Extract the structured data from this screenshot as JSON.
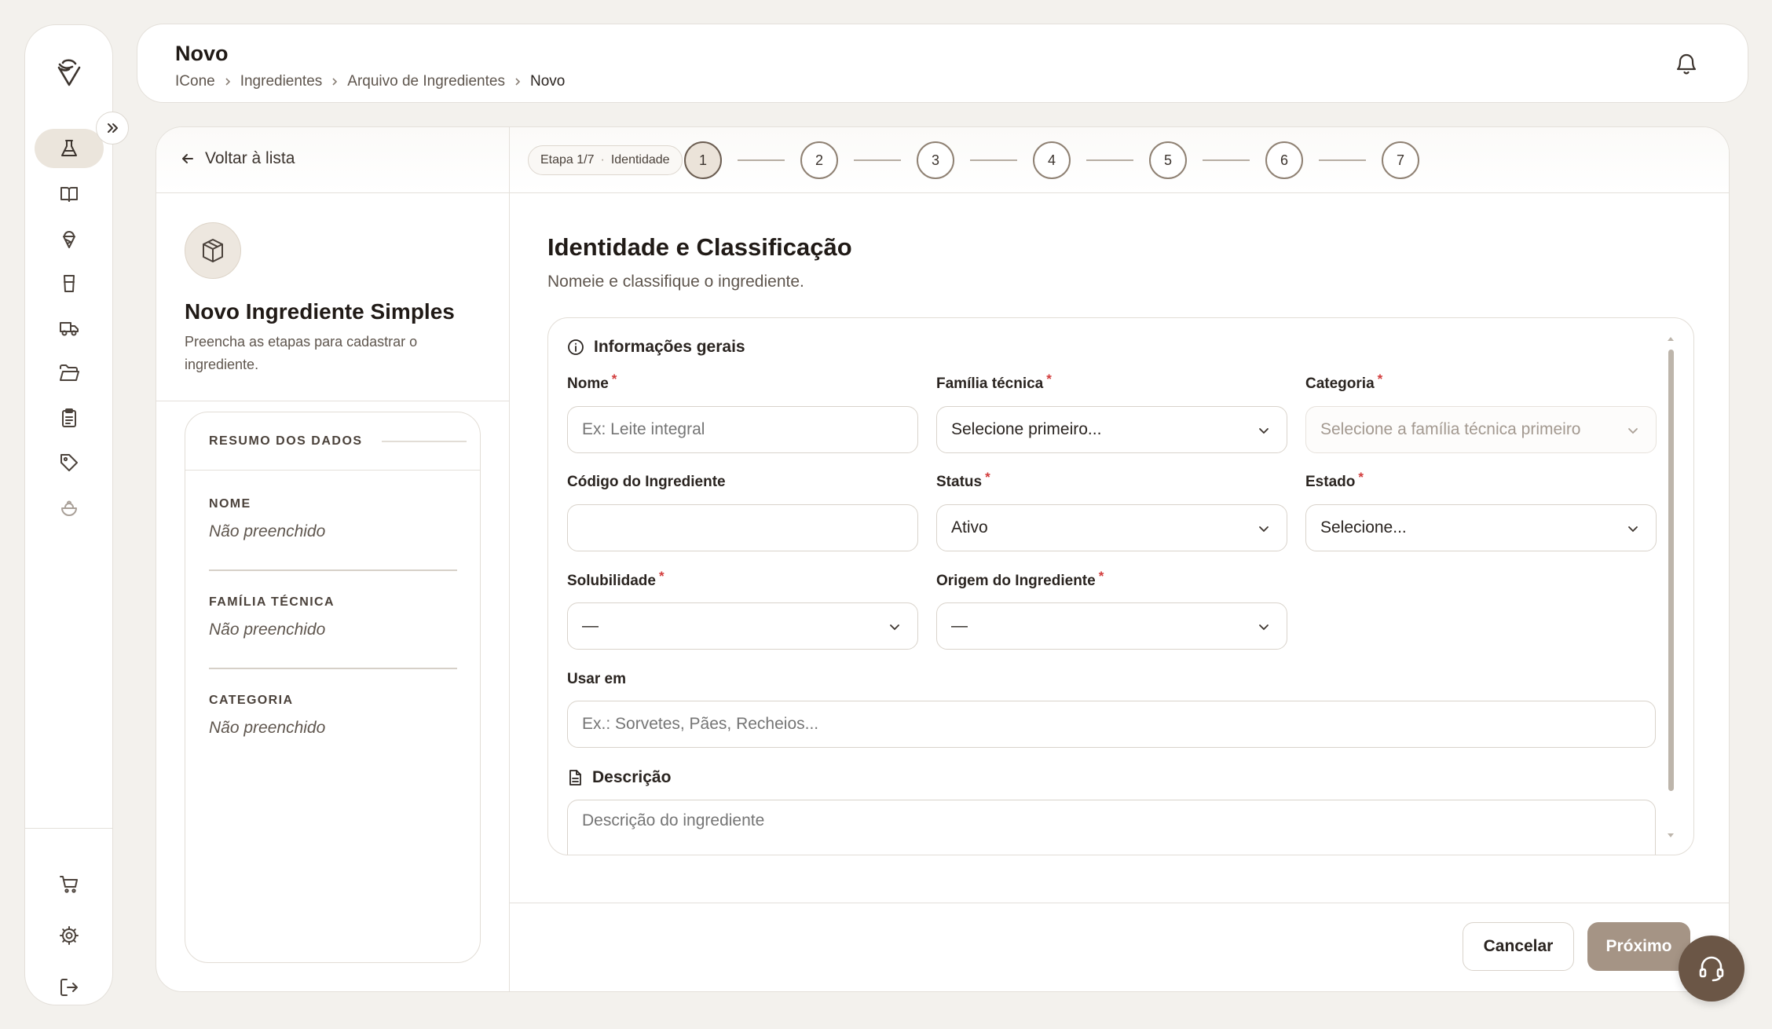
{
  "header": {
    "title": "Novo",
    "breadcrumb": [
      "ICone",
      "Ingredientes",
      "Arquivo de Ingredientes",
      "Novo"
    ]
  },
  "sidebar": {
    "items": [
      {
        "icon": "flask-icon",
        "active": true
      },
      {
        "icon": "book-icon"
      },
      {
        "icon": "ice-cream-icon"
      },
      {
        "icon": "cup-icon"
      },
      {
        "icon": "truck-icon"
      },
      {
        "icon": "folder-icon"
      },
      {
        "icon": "clipboard-icon"
      },
      {
        "icon": "tag-icon"
      },
      {
        "icon": "bowl-icon"
      }
    ],
    "bottom_items": [
      {
        "icon": "cart-icon"
      },
      {
        "icon": "gear-icon"
      },
      {
        "icon": "logout-icon"
      }
    ]
  },
  "left_panel": {
    "back_label": "Voltar à lista",
    "title": "Novo Ingrediente Simples",
    "subtitle": "Preencha as etapas para cadastrar o ingrediente.",
    "summary": {
      "heading": "RESUMO DOS DADOS",
      "items": [
        {
          "label": "NOME",
          "value": "Não preenchido"
        },
        {
          "label": "FAMÍLIA TÉCNICA",
          "value": "Não preenchido"
        },
        {
          "label": "CATEGORIA",
          "value": "Não preenchido"
        }
      ]
    }
  },
  "stepper": {
    "pill_step": "Etapa 1/7",
    "pill_name": "Identidade",
    "steps": [
      "1",
      "2",
      "3",
      "4",
      "5",
      "6",
      "7"
    ],
    "current": 1
  },
  "form": {
    "title": "Identidade e Classificação",
    "subtitle": "Nomeie e classifique o ingrediente.",
    "group_title": "Informações gerais",
    "fields": {
      "nome": {
        "label": "Nome",
        "required": true,
        "placeholder": "Ex: Leite integral",
        "value": ""
      },
      "familia": {
        "label": "Família técnica",
        "required": true,
        "value": "Selecione primeiro..."
      },
      "categoria": {
        "label": "Categoria",
        "required": true,
        "value": "Selecione a família técnica primeiro"
      },
      "codigo": {
        "label": "Código do Ingrediente",
        "required": false,
        "value": ""
      },
      "status": {
        "label": "Status",
        "required": true,
        "value": "Ativo"
      },
      "estado": {
        "label": "Estado",
        "required": true,
        "value": "Selecione..."
      },
      "solubilidade": {
        "label": "Solubilidade",
        "required": true,
        "value": "—"
      },
      "origem": {
        "label": "Origem do Ingrediente",
        "required": true,
        "value": "—"
      },
      "usar_em": {
        "label": "Usar em",
        "required": false,
        "placeholder": "Ex.: Sorvetes, Pães, Recheios..."
      }
    },
    "description": {
      "label": "Descrição",
      "placeholder": "Descrição do ingrediente"
    }
  },
  "footer": {
    "cancel_label": "Cancelar",
    "next_label": "Próximo"
  },
  "colors": {
    "accent": "#6b5646",
    "next_button": "#a59485",
    "required": "#d23b3b"
  }
}
